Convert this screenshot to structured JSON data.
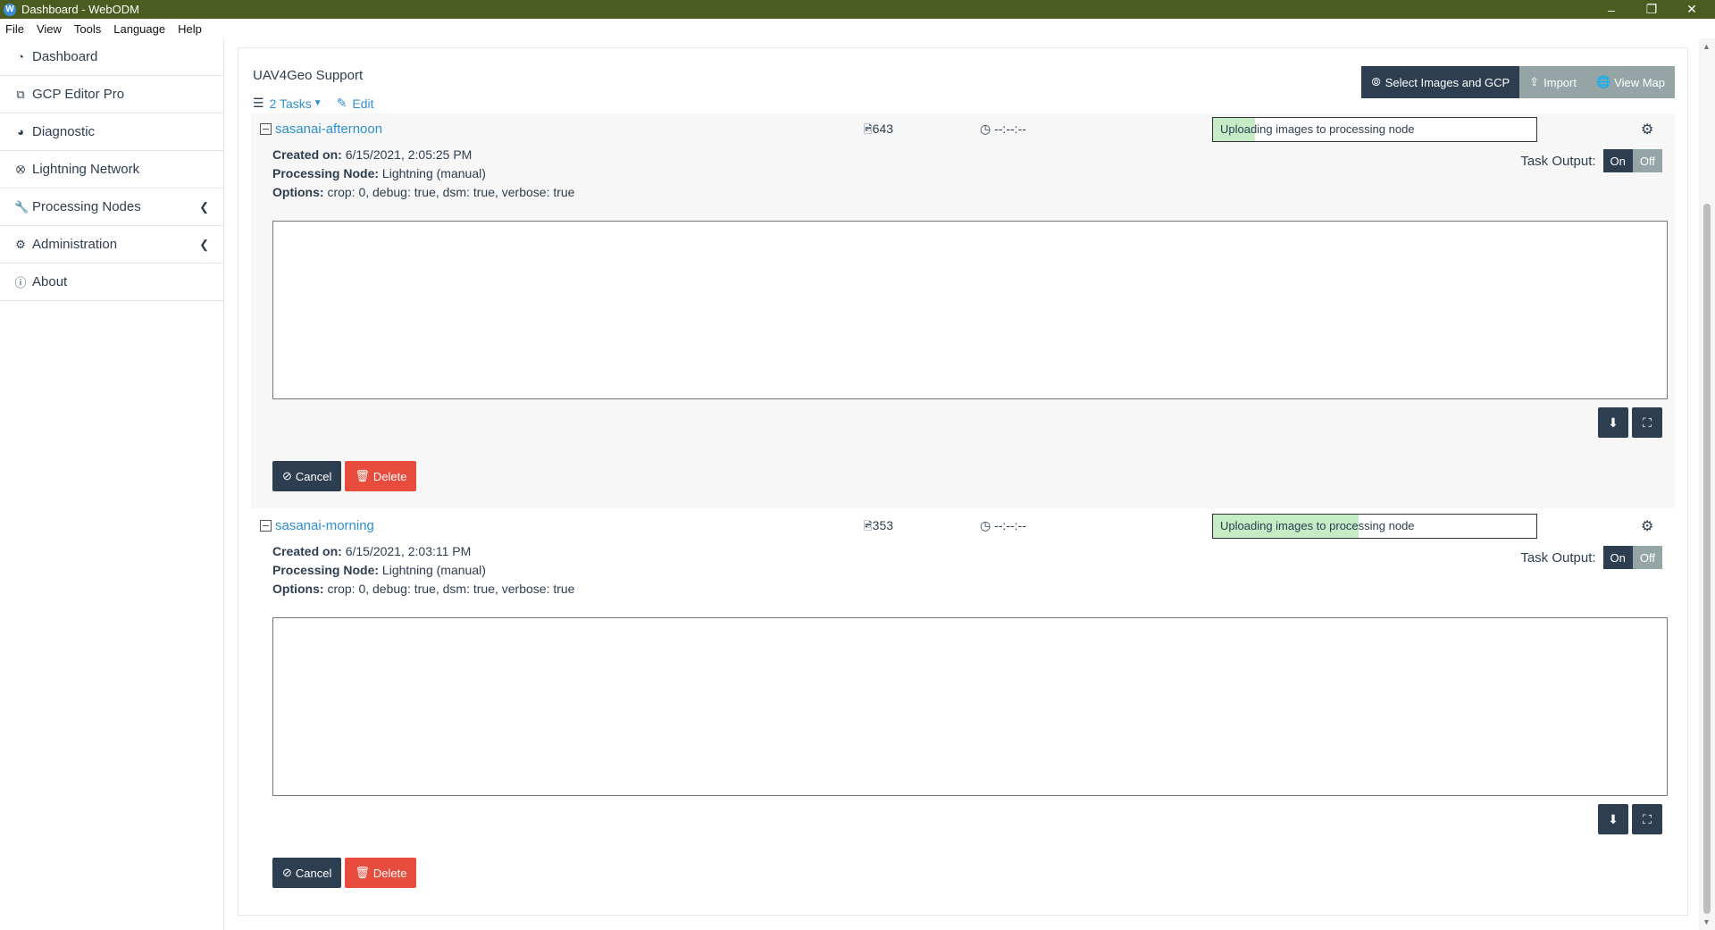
{
  "window": {
    "title": "Dashboard - WebODM"
  },
  "menu": [
    "File",
    "View",
    "Tools",
    "Language",
    "Help"
  ],
  "sidebar": {
    "items": [
      {
        "label": "Dashboard",
        "icon": "dashboard-icon"
      },
      {
        "label": "GCP Editor Pro",
        "icon": "external-link-icon"
      },
      {
        "label": "Diagnostic",
        "icon": "pie-chart-icon"
      },
      {
        "label": "Lightning Network",
        "icon": "bolt-icon"
      },
      {
        "label": "Processing Nodes",
        "icon": "wrench-icon"
      },
      {
        "label": "Administration",
        "icon": "gears-icon"
      },
      {
        "label": "About",
        "icon": "info-icon"
      }
    ]
  },
  "project": {
    "title": "UAV4Geo Support",
    "tasks_link": "2 Tasks",
    "edit_link": "Edit",
    "buttons": {
      "select_images": "Select Images and GCP",
      "import": "Import",
      "view_map": "View Map"
    }
  },
  "tasks": [
    {
      "name": "sasanai-afternoon",
      "images": "643",
      "duration": "--:--:--",
      "status": "Uploading images to processing node",
      "progress": 0.13,
      "created_label": "Created on:",
      "created": "6/15/2021, 2:05:25 PM",
      "node_label": "Processing Node:",
      "node": "Lightning (manual)",
      "options_label": "Options:",
      "options": "crop: 0, debug: true, dsm: true, verbose: true",
      "task_output_label": "Task Output:",
      "on": "On",
      "off": "Off",
      "cancel": "Cancel",
      "delete": "Delete"
    },
    {
      "name": "sasanai-morning",
      "images": "353",
      "duration": "--:--:--",
      "status": "Uploading images to processing node",
      "progress": 0.45,
      "created_label": "Created on:",
      "created": "6/15/2021, 2:03:11 PM",
      "node_label": "Processing Node:",
      "node": "Lightning (manual)",
      "options_label": "Options:",
      "options": "crop: 0, debug: true, dsm: true, verbose: true",
      "task_output_label": "Task Output:",
      "on": "On",
      "off": "Off",
      "cancel": "Cancel",
      "delete": "Delete"
    }
  ]
}
